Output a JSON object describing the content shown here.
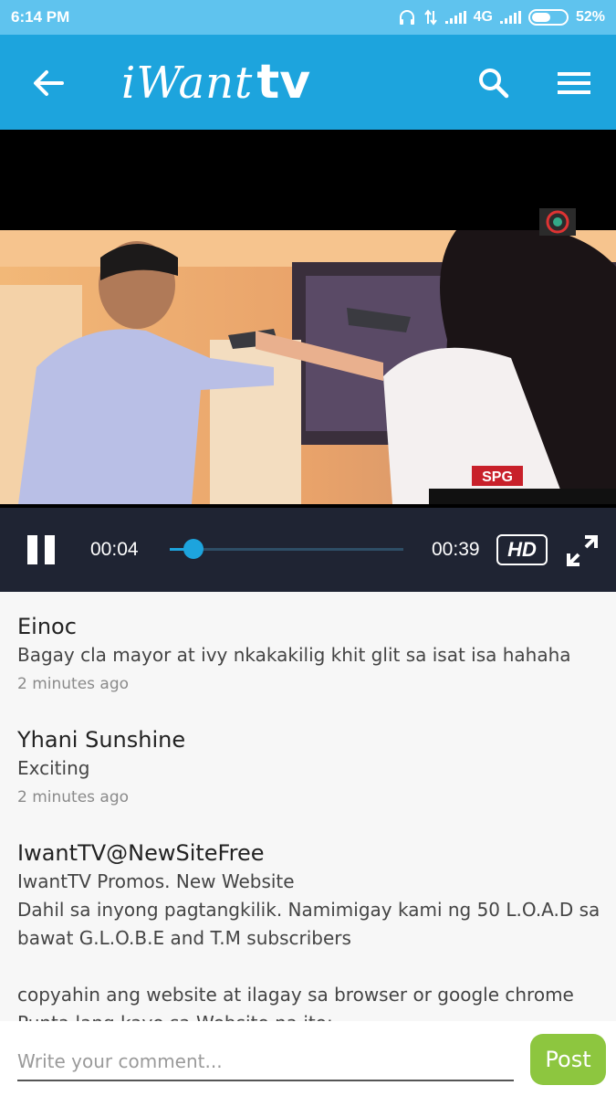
{
  "status_bar": {
    "time": "6:14 PM",
    "network": "4G",
    "battery": "52%",
    "icons": [
      "headphones-icon",
      "data-transfer-icon",
      "signal-icon",
      "signal-icon",
      "battery-icon"
    ]
  },
  "app_bar": {
    "logo_script": "iWant",
    "logo_tv": "tv",
    "icons": [
      "back-arrow-icon",
      "search-icon",
      "hamburger-menu-icon"
    ]
  },
  "player": {
    "current_time": "00:04",
    "total_time": "00:39",
    "progress_fraction": 0.1,
    "hd_label": "HD",
    "icons": [
      "pause-icon",
      "fullscreen-icon"
    ]
  },
  "comments": [
    {
      "author": "Einoc",
      "text": "Bagay cla mayor at ivy nkakakilig khit glit sa isat isa hahaha",
      "time": "2 minutes ago"
    },
    {
      "author": "Yhani Sunshine",
      "text": "Exciting",
      "time": "2 minutes ago"
    },
    {
      "author": "IwantTV@NewSiteFree",
      "text": "IwantTV Promos. New Website\nDahil sa inyong pagtangkilik. Namimigay kami ng 50 L.O.A.D sa bawat G.L.O.B.E and T.M subscribers\n\ncopyahin ang website at ilagay sa browser or google chrome\nPunta lang kayo sa Website na ito:",
      "time": ""
    }
  ],
  "composer": {
    "placeholder": "Write your comment...",
    "post_label": "Post"
  },
  "colors": {
    "status_bar": "#5fc3ee",
    "app_bar": "#1da4dd",
    "player_bar": "#1f2433",
    "post_button": "#8dc63f"
  }
}
